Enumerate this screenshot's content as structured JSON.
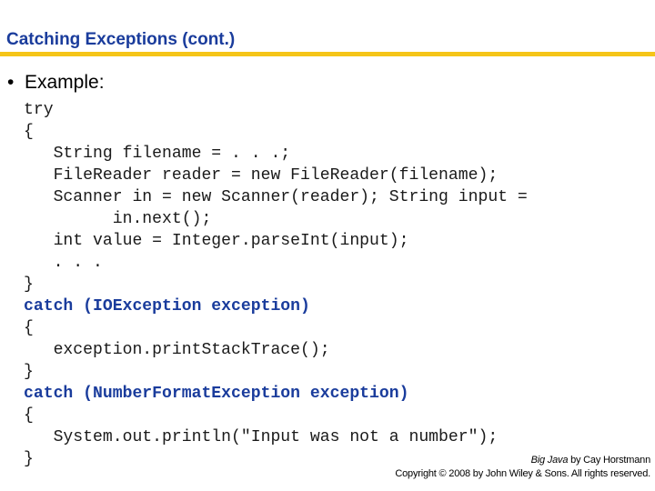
{
  "slide": {
    "title": "Catching Exceptions  (cont.)",
    "accent_color": "#f5c518",
    "title_color": "#1a3c9c",
    "bullet": {
      "glyph": "•",
      "text": "Example:"
    },
    "code_lines": [
      {
        "text": "try",
        "keyword": false
      },
      {
        "text": "{",
        "keyword": false
      },
      {
        "text": "   String filename = . . .;",
        "keyword": false
      },
      {
        "text": "   FileReader reader = new FileReader(filename);",
        "keyword": false
      },
      {
        "text": "   Scanner in = new Scanner(reader); String input =",
        "keyword": false
      },
      {
        "text": "         in.next();",
        "keyword": false
      },
      {
        "text": "   int value = Integer.parseInt(input);",
        "keyword": false
      },
      {
        "text": "   . . .",
        "keyword": false
      },
      {
        "text": "}",
        "keyword": false
      },
      {
        "text": "catch (IOException exception)",
        "keyword": true
      },
      {
        "text": "{",
        "keyword": false
      },
      {
        "text": "   exception.printStackTrace();",
        "keyword": false
      },
      {
        "text": "}",
        "keyword": false
      },
      {
        "text": "catch (NumberFormatException exception)",
        "keyword": true
      },
      {
        "text": "{",
        "keyword": false
      },
      {
        "text": "   System.out.println(\"Input was not a number\");",
        "keyword": false
      },
      {
        "text": "}",
        "keyword": false
      }
    ],
    "footer": {
      "book_title": "Big Java",
      "author": " by Cay Horstmann",
      "copyright": "Copyright © 2008 by John Wiley & Sons.  All rights reserved."
    }
  }
}
